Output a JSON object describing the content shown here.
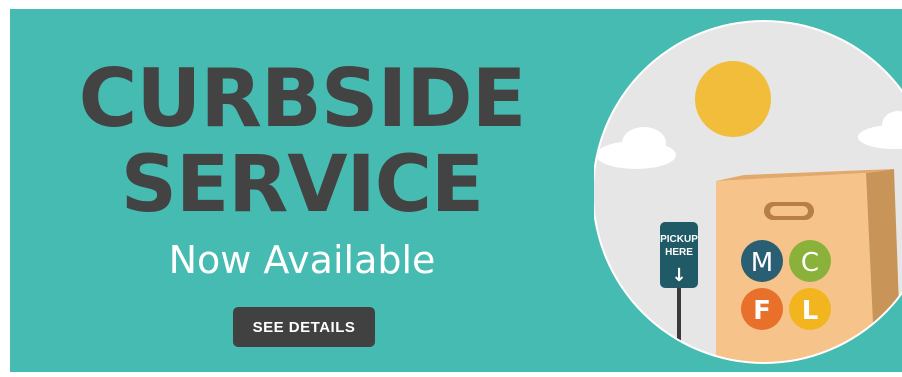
{
  "banner": {
    "headline_line1": "CURBSIDE",
    "headline_line2": "SERVICE",
    "subhead": "Now Available",
    "cta_label": "SEE DETAILS"
  },
  "illustration": {
    "sign_line1": "PICKUP",
    "sign_line2": "HERE",
    "sign_arrow": "↓",
    "bag_letters": [
      "M",
      "C",
      "F",
      "L"
    ]
  },
  "colors": {
    "background": "#46bbb1",
    "headline": "#434343",
    "subhead": "#ffffff",
    "button": "#414141",
    "sun": "#f1bd3a",
    "bag": "#f6c48b",
    "sign": "#1f5a66",
    "letter_m": "#2a5f73",
    "letter_c": "#8ab23b",
    "letter_f": "#e8702a",
    "letter_l": "#f2b51f"
  }
}
